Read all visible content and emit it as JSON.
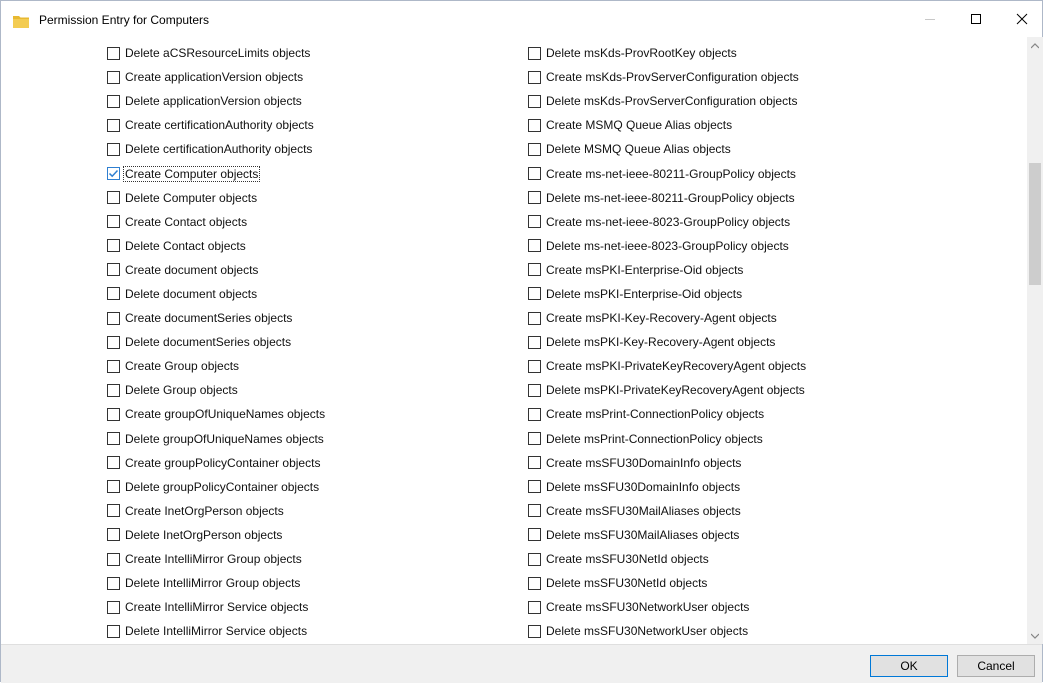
{
  "window": {
    "title": "Permission Entry for Computers",
    "icon": "folder-icon",
    "controls": [
      "minimize-icon",
      "maximize-icon",
      "close-icon"
    ]
  },
  "permissions_left": [
    {
      "label": "Delete aCSResourceLimits objects",
      "checked": false
    },
    {
      "label": "Create applicationVersion objects",
      "checked": false
    },
    {
      "label": "Delete applicationVersion objects",
      "checked": false
    },
    {
      "label": "Create certificationAuthority objects",
      "checked": false
    },
    {
      "label": "Delete certificationAuthority objects",
      "checked": false
    },
    {
      "label": "Create Computer objects",
      "checked": true
    },
    {
      "label": "Delete Computer objects",
      "checked": false
    },
    {
      "label": "Create Contact objects",
      "checked": false
    },
    {
      "label": "Delete Contact objects",
      "checked": false
    },
    {
      "label": "Create document objects",
      "checked": false
    },
    {
      "label": "Delete document objects",
      "checked": false
    },
    {
      "label": "Create documentSeries objects",
      "checked": false
    },
    {
      "label": "Delete documentSeries objects",
      "checked": false
    },
    {
      "label": "Create Group objects",
      "checked": false
    },
    {
      "label": "Delete Group objects",
      "checked": false
    },
    {
      "label": "Create groupOfUniqueNames objects",
      "checked": false
    },
    {
      "label": "Delete groupOfUniqueNames objects",
      "checked": false
    },
    {
      "label": "Create groupPolicyContainer objects",
      "checked": false
    },
    {
      "label": "Delete groupPolicyContainer objects",
      "checked": false
    },
    {
      "label": "Create InetOrgPerson objects",
      "checked": false
    },
    {
      "label": "Delete InetOrgPerson objects",
      "checked": false
    },
    {
      "label": "Create IntelliMirror Group objects",
      "checked": false
    },
    {
      "label": "Delete IntelliMirror Group objects",
      "checked": false
    },
    {
      "label": "Create IntelliMirror Service objects",
      "checked": false
    },
    {
      "label": "Delete IntelliMirror Service objects",
      "checked": false
    }
  ],
  "permissions_right": [
    {
      "label": "Delete msKds-ProvRootKey objects",
      "checked": false
    },
    {
      "label": "Create msKds-ProvServerConfiguration objects",
      "checked": false
    },
    {
      "label": "Delete msKds-ProvServerConfiguration objects",
      "checked": false
    },
    {
      "label": "Create MSMQ Queue Alias objects",
      "checked": false
    },
    {
      "label": "Delete MSMQ Queue Alias objects",
      "checked": false
    },
    {
      "label": "Create ms-net-ieee-80211-GroupPolicy objects",
      "checked": false
    },
    {
      "label": "Delete ms-net-ieee-80211-GroupPolicy objects",
      "checked": false
    },
    {
      "label": "Create ms-net-ieee-8023-GroupPolicy objects",
      "checked": false
    },
    {
      "label": "Delete ms-net-ieee-8023-GroupPolicy objects",
      "checked": false
    },
    {
      "label": "Create msPKI-Enterprise-Oid objects",
      "checked": false
    },
    {
      "label": "Delete msPKI-Enterprise-Oid objects",
      "checked": false
    },
    {
      "label": "Create msPKI-Key-Recovery-Agent objects",
      "checked": false
    },
    {
      "label": "Delete msPKI-Key-Recovery-Agent objects",
      "checked": false
    },
    {
      "label": "Create msPKI-PrivateKeyRecoveryAgent objects",
      "checked": false
    },
    {
      "label": "Delete msPKI-PrivateKeyRecoveryAgent objects",
      "checked": false
    },
    {
      "label": "Create msPrint-ConnectionPolicy objects",
      "checked": false
    },
    {
      "label": "Delete msPrint-ConnectionPolicy objects",
      "checked": false
    },
    {
      "label": "Create msSFU30DomainInfo objects",
      "checked": false
    },
    {
      "label": "Delete msSFU30DomainInfo objects",
      "checked": false
    },
    {
      "label": "Create msSFU30MailAliases objects",
      "checked": false
    },
    {
      "label": "Delete msSFU30MailAliases objects",
      "checked": false
    },
    {
      "label": "Create msSFU30NetId objects",
      "checked": false
    },
    {
      "label": "Delete msSFU30NetId objects",
      "checked": false
    },
    {
      "label": "Create msSFU30NetworkUser objects",
      "checked": false
    },
    {
      "label": "Delete msSFU30NetworkUser objects",
      "checked": false
    }
  ],
  "footer": {
    "ok_label": "OK",
    "cancel_label": "Cancel"
  },
  "colors": {
    "checkmark": "#2f7fd0",
    "ok_border": "#0078d7",
    "footer_bg": "#f0f0f0",
    "folder": "#e8b931"
  }
}
